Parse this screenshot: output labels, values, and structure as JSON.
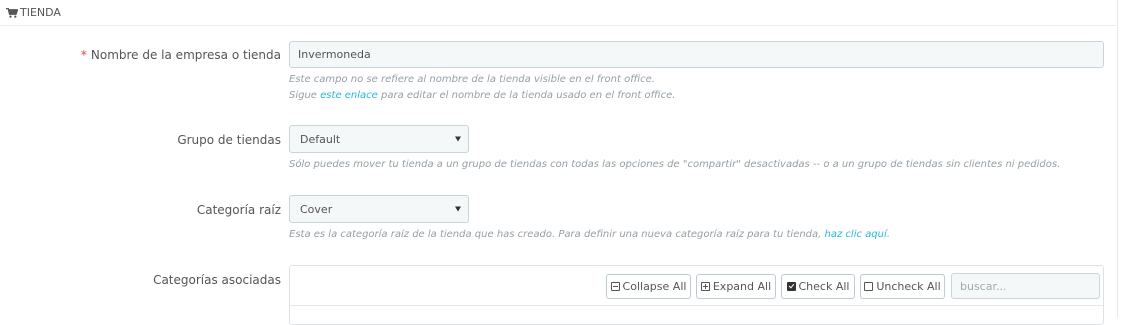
{
  "panel": {
    "title": "TIENDA",
    "icon": "cart-icon"
  },
  "fields": {
    "shop_name": {
      "required_mark": "*",
      "label": "Nombre de la empresa o tienda",
      "value": "Invermoneda",
      "help_line1": "Este campo no se refiere al nombre de la tienda visible en el front office.",
      "help_line2_pre": "Sigue ",
      "help_line2_link": "este enlace",
      "help_line2_post": " para editar el nombre de la tienda usado en el front office."
    },
    "shop_group": {
      "label": "Grupo de tiendas",
      "selected": "Default",
      "help": "Sólo puedes mover tu tienda a un grupo de tiendas con todas las opciones de \"compartir\" desactivadas -- o a un grupo de tiendas sin clientes ni pedidos."
    },
    "root_category": {
      "label": "Categoría raíz",
      "selected": "Cover",
      "help_pre": "Esta es la categoría raíz de la tienda que has creado. Para definir una nueva categoría raíz para tu tienda, ",
      "help_link": "haz clic aquí",
      "help_post": "."
    },
    "associated_categories": {
      "label": "Categorías asociadas",
      "collapse_all": "Collapse All",
      "expand_all": "Expand All",
      "check_all": "Check All",
      "uncheck_all": "Uncheck All",
      "search_placeholder": "buscar..."
    }
  },
  "colors": {
    "accent": "#25b9d7",
    "required": "#e3433a",
    "help_text": "#959fa6"
  }
}
